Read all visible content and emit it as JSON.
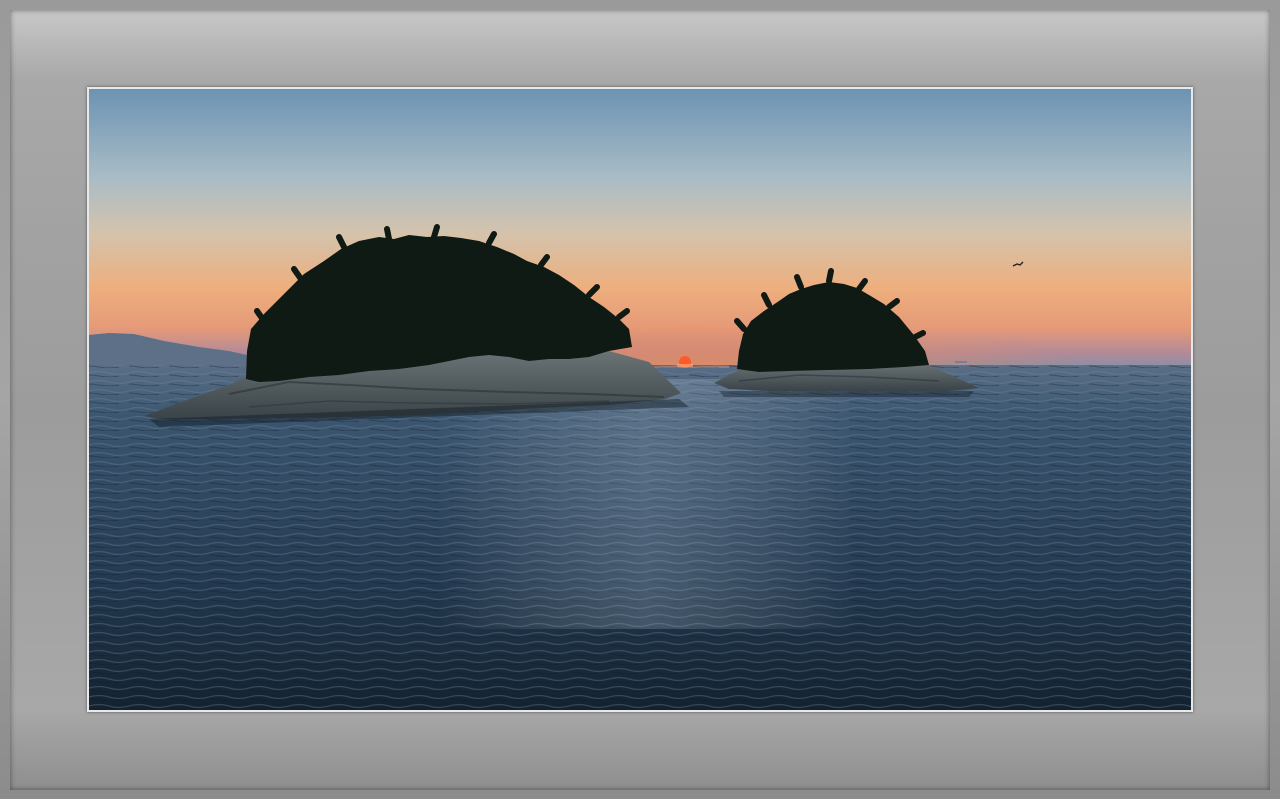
{
  "image": {
    "subject": "sunset-over-sea-with-two-wooded-islands",
    "colors": {
      "sky_top": "#6f95b4",
      "sky_mid": "#b9c2c4",
      "horizon_glow": "#f2a56a",
      "horizon_pink": "#c98a8e",
      "sun": "#ff5a2a",
      "sea_light": "#3f5a72",
      "sea_dark": "#142433",
      "island_trees": "#101a14",
      "island_rock": "#5d6668",
      "frame": "#a0a0a0",
      "mat": "#e8e8e8"
    }
  }
}
